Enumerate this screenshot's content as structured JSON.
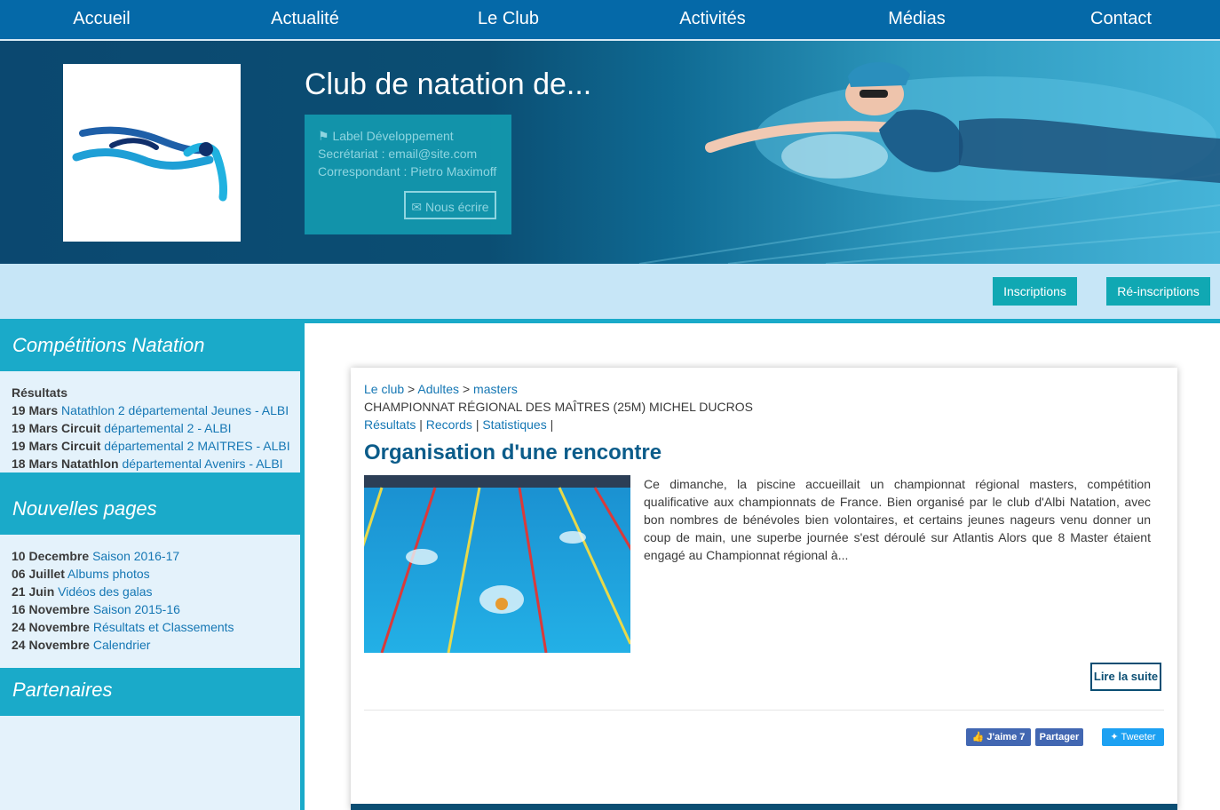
{
  "nav": {
    "items": [
      "Accueil",
      "Actualité",
      "Le Club",
      "Activités",
      "Médias",
      "Contact"
    ]
  },
  "header": {
    "title": "Club de natation de...",
    "label": "Label Développement",
    "secretariat": "Secrétariat : email@site.com",
    "correspondant": "Correspondant : Pietro Maximoff",
    "write_button": "Nous écrire"
  },
  "subbar": {
    "inscriptions": "Inscriptions",
    "reinscriptions": "Ré-inscriptions"
  },
  "sidebar": {
    "competitions": {
      "title": "Compétitions Natation",
      "heading": "Résultats",
      "rows": [
        {
          "date": "19 Mars",
          "link": "Natathlon 2 départemental Jeunes - ALBI"
        },
        {
          "date": "19 Mars Circuit",
          "link": "départemental 2 - ALBI"
        },
        {
          "date": "19 Mars Circuit",
          "link": "départemental 2 MAITRES - ALBI"
        },
        {
          "date": "18 Mars Natathlon",
          "link": "départemental Avenirs - ALBI"
        }
      ]
    },
    "new_pages": {
      "title": "Nouvelles pages",
      "rows": [
        {
          "date": "10 Decembre",
          "link": "Saison 2016-17"
        },
        {
          "date": "06 Juillet",
          "link": "Albums photos"
        },
        {
          "date": "21 Juin",
          "link": "Vidéos des galas"
        },
        {
          "date": "16 Novembre",
          "link": "Saison 2015-16"
        },
        {
          "date": "24 Novembre",
          "link": "Résultats et Classements"
        },
        {
          "date": "24 Novembre",
          "link": "Calendrier"
        }
      ]
    },
    "partners": {
      "title": "Partenaires"
    }
  },
  "article": {
    "breadcrumb": {
      "club": "Le club",
      "sep1": ">",
      "adults": "Adultes",
      "sep2": ">",
      "masters": "masters"
    },
    "event": "CHAMPIONNAT RÉGIONAL DES MAÎTRES (25M) MICHEL DUCROS",
    "links": {
      "results": "Résultats",
      "records": "Records",
      "stats": "Statistiques",
      "sep": "|"
    },
    "title": "Organisation d'une rencontre",
    "text": "Ce dimanche, la piscine accueillait un championnat régional masters, compétition qualificative aux championnats de France. Bien organisé par le club d'Albi Natation, avec bon nombres de bénévoles bien volontaires, et certains jeunes nageurs venu donner un coup de main, une superbe journée s'est déroulé sur Atlantis Alors que 8 Master étaient engagé au Championnat régional à...",
    "read_more": "Lire la suite"
  },
  "social": {
    "like": "J'aime 7",
    "share": "Partager",
    "tweet": "Tweeter"
  },
  "icons": {
    "tag": "tag-icon",
    "mail": "envelope-icon",
    "thumb": "thumbs-up-icon",
    "twitter": "twitter-bird-icon"
  },
  "colors": {
    "nav": "#0569a8",
    "header": "#0b4e73",
    "accent": "#1aaac9",
    "button": "#10a8b3",
    "link": "#1577b4"
  }
}
